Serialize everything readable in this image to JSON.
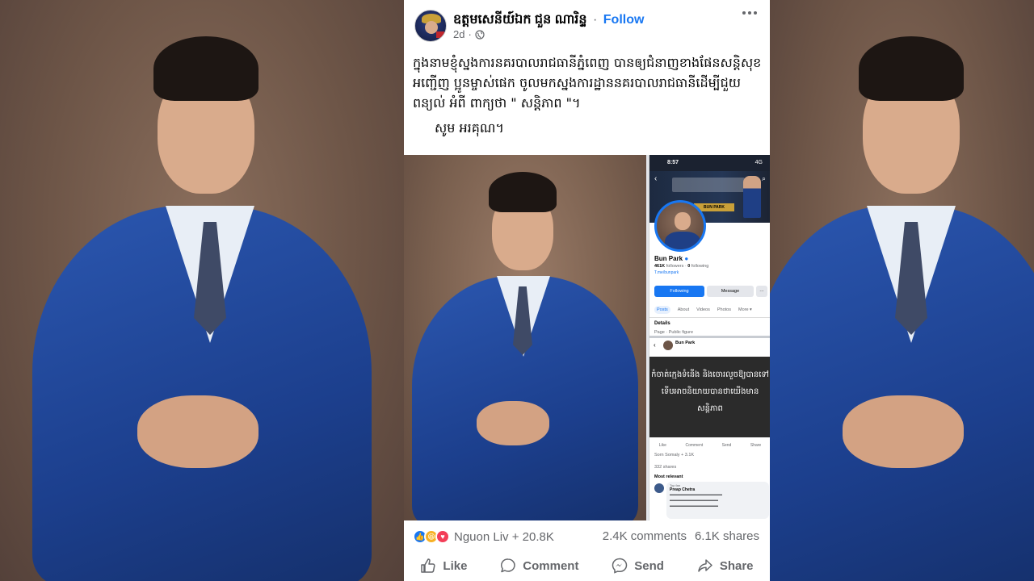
{
  "post": {
    "author": "ឧត្តមសេនីយ៍ឯក ជួន ណារិន្ទ",
    "separator": "·",
    "follow_label": "Follow",
    "time": "2d",
    "text_paragraph": "ក្នុងនាមខ្ញុំស្នងការនគរបាលរាជធានីភ្នំពេញ បានឲ្យជំនាញខាងផែនសន្តិសុខ អញ្ជើញ ប្អូនម្ចាស់ផេក ចូលមកស្នងការដ្ឋាននគរបាលរាជធានីដើម្បីជួយពន្យល់ អំពី ពាក្យថា  \" សន្តិភាព \"។",
    "text_thanks": "សូម អរគុណ។"
  },
  "screenshot": {
    "status_time": "8:57",
    "status_signal": "4G",
    "profile_name": "Bun Park",
    "followers": "461K",
    "followers_label": "followers",
    "following": "0",
    "following_label": "following",
    "link": "T.me/bunpark",
    "cover_tag": "BUN PARK",
    "following_btn": "Following",
    "message_btn": "Message",
    "more_btn": "···",
    "tabs": [
      "Posts",
      "About",
      "Videos",
      "Photos",
      "More ▾"
    ],
    "details": "Details",
    "page_type": "Page · Public figure",
    "post_author": "Bun Park",
    "post_khmer": "កំចាត់ក្មេងទំនើង និងចោរលួចឱ្យបានទៅ ទើបអាចនិយាយបានថាយើងមានសន្តិភាព",
    "actions": [
      "Like",
      "Comment",
      "Send",
      "Share"
    ],
    "reactions": "Sorn Somaly + 3.1K",
    "shares": "332 shares",
    "most_relevant": "Most relevant",
    "commenter": "Preap Chetra",
    "commenter_badge": "Top fan"
  },
  "stats": {
    "reaction_names": "Nguon Liv + 20.8K",
    "comments": "2.4K comments",
    "shares": "6.1K shares"
  },
  "actions": {
    "like": "Like",
    "comment": "Comment",
    "send": "Send",
    "share": "Share"
  },
  "colors": {
    "accent": "#1877f2",
    "muted": "#65676b",
    "background": "#6b5446"
  }
}
